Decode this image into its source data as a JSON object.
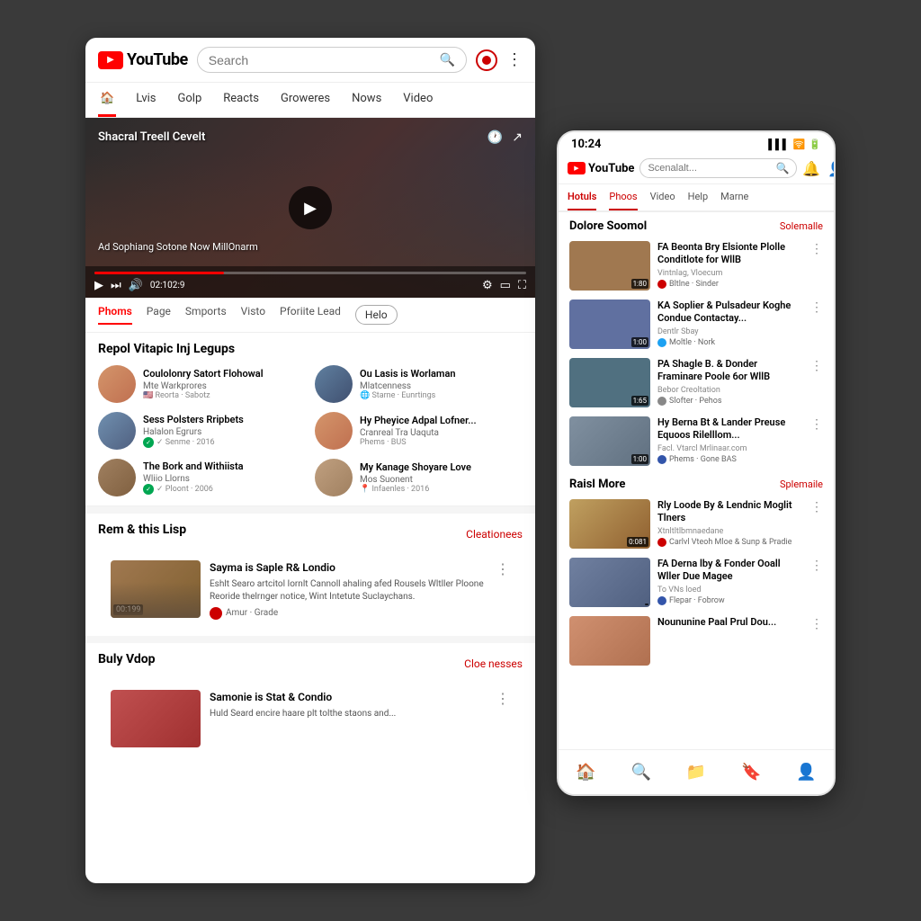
{
  "app": {
    "title": "YouTube"
  },
  "desktop": {
    "header": {
      "logo_text": "YouTube",
      "search_placeholder": "Search"
    },
    "nav_tabs": [
      {
        "label": "🏠",
        "id": "home",
        "active": true
      },
      {
        "label": "Lvis",
        "id": "lvis"
      },
      {
        "label": "Golp",
        "id": "golp"
      },
      {
        "label": "Reacts",
        "id": "reacts"
      },
      {
        "label": "Groweres",
        "id": "groweres"
      },
      {
        "label": "Nows",
        "id": "nows"
      },
      {
        "label": "Video",
        "id": "video"
      }
    ],
    "video_player": {
      "title": "Shacral Treell Cevelt",
      "time": "02:102:9",
      "ad_text": "Ad Sophiang Sotone Now MillOnarm"
    },
    "content_tabs": [
      {
        "label": "Phoms",
        "active": true
      },
      {
        "label": "Page"
      },
      {
        "label": "Smports"
      },
      {
        "label": "Visto"
      },
      {
        "label": "Pforiite Lead"
      },
      {
        "label": "Helo",
        "btn": true
      }
    ],
    "people_section": {
      "title": "Repol Vitapic Inj Legups",
      "people": [
        {
          "name": "Coulolonry Satort Flohowal",
          "sub": "Mte Warkprores",
          "meta": "🇺🇸 Reorta · Sabotz",
          "avatar": "1"
        },
        {
          "name": "Ou Lasis is Worlaman",
          "sub": "Mlatcenness",
          "meta": "🌐 Starne · Eunrtings",
          "avatar": "2"
        },
        {
          "name": "Sess Polsters Rripbets",
          "sub": "Halalon Egrurs",
          "meta": "✓ Senme · 2016",
          "avatar": "3",
          "verified": true
        },
        {
          "name": "Hy Pheyice Adpal Lofner...",
          "sub": "Cranreal Tra Uaquta",
          "meta": "Phems · BUS",
          "avatar": "4",
          "verified2": true
        },
        {
          "name": "The Bork and Withiista",
          "sub": "Wliio Llorns",
          "meta": "✓ Ploont · 2006",
          "avatar": "5",
          "verified": true
        },
        {
          "name": "My Kanage Shoyare Love",
          "sub": "Mos Suonent",
          "meta": "📍 Infaenles · 2016",
          "avatar": "6",
          "verified2": true
        }
      ]
    },
    "list_section": {
      "title": "Rem & this Lisp",
      "see_all": "Cleationees",
      "items": [
        {
          "title": "Sayma is Saple R& Londio",
          "desc": "Eshlt Searo artcitol Iornlt Cannoll ahaling afed Rousels Wltller Ploone Reoride thelrnger notice, Wint Intetute Suclaychans.",
          "channel": "Amur",
          "channel_sub": "Grade",
          "duration": "00:199"
        }
      ]
    },
    "second_list": {
      "title": "Buly Vdop",
      "see_all": "Cloe nesses",
      "items": [
        {
          "title": "Samonie is Stat & Condio",
          "desc": "Huld Seard encire haare plt tolthe staons and...",
          "duration": ""
        }
      ]
    }
  },
  "mobile": {
    "status_bar": {
      "time": "10:24",
      "icons": "▌▌▌ ⊛ ▐▐"
    },
    "header": {
      "logo_text": "YouTube",
      "search_placeholder": "Scenalalt..."
    },
    "nav_tabs": [
      {
        "label": "Hotuls",
        "active": true
      },
      {
        "label": "Phoos",
        "active2": true
      },
      {
        "label": "Video"
      },
      {
        "label": "Help"
      },
      {
        "label": "Marne"
      }
    ],
    "section1": {
      "title": "Dolore Soomol",
      "see_all": "Solemalle",
      "videos": [
        {
          "title": "FA Beonta Bry Elsionte Plolle Conditlote for WllB",
          "meta": "Vintnlag, Vloecum",
          "channel": "Bltlne · Sinder",
          "duration": "1:80",
          "thumb_color": "brown"
        },
        {
          "title": "KA Soplier & Pulsadeur Koghe Condue Contactay...",
          "meta": "Dentlr Sbay",
          "channel": "Moltle · Nork",
          "duration": "1:00",
          "thumb_color": "blue"
        },
        {
          "title": "PA Shagle B. & Donder Framinare Poole 6or WllB",
          "meta": "Bebor Creoltation",
          "channel": "Slofter · Pehos",
          "duration": "1:65",
          "thumb_color": "teal"
        },
        {
          "title": "Hy Berna Bt & Lander Preuse Equoos Rilelllom...",
          "meta": "Facl. Vtarcl Mrlinaar.com",
          "channel": "Phems · Gone BAS",
          "duration": "1:00",
          "thumb_color": "brown"
        }
      ]
    },
    "section2": {
      "title": "Raisl More",
      "see_all": "Splemaile",
      "videos": [
        {
          "title": "Rly Loode By & Lendnic Moglit Tlners",
          "meta": "Xtnltltlbmnaedane",
          "channel": "Carlvl Vteoh Mloe & Sunp & Pradie",
          "duration": "0:081",
          "thumb_color": "brown"
        },
        {
          "title": "FA Derna lby & Fonder Ooall Wller Due Magee",
          "meta": "To VNs loed",
          "channel": "Flepar · Fobrow",
          "duration": "",
          "thumb_color": "blue"
        }
      ]
    },
    "bottom_nav": [
      {
        "icon": "🏠",
        "active": true
      },
      {
        "icon": "🔍"
      },
      {
        "icon": "📁"
      },
      {
        "icon": "🔖"
      },
      {
        "icon": "👤"
      }
    ]
  }
}
